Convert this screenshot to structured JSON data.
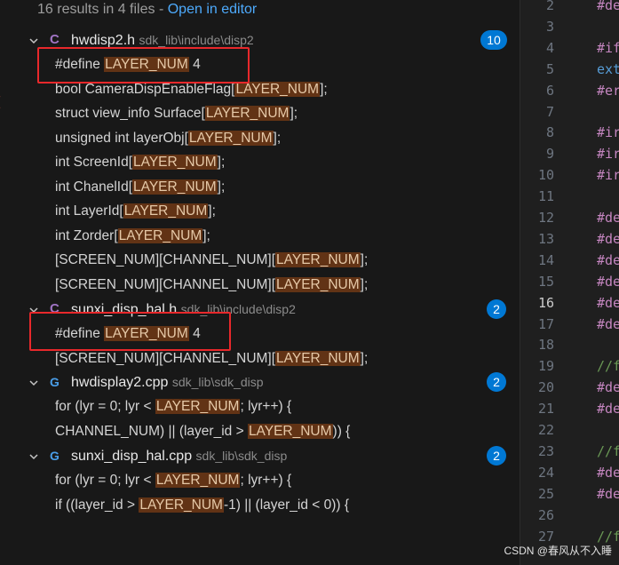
{
  "search": {
    "summary": "16 results in 4 files - ",
    "open_in_editor": "Open in editor"
  },
  "files": [
    {
      "name": "hwdisp2.h",
      "path": "sdk_lib\\include\\disp2",
      "icon": "c-header-icon",
      "icon_glyph": "C",
      "count": "10",
      "matches": [
        [
          "#define ",
          "LAYER_NUM",
          " 4"
        ],
        [
          "bool CameraDispEnableFlag[",
          "LAYER_NUM",
          "];"
        ],
        [
          "struct view_info Surface[",
          "LAYER_NUM",
          "];"
        ],
        [
          "unsigned int layerObj[",
          "LAYER_NUM",
          "];"
        ],
        [
          "int ScreenId[",
          "LAYER_NUM",
          "];"
        ],
        [
          "int ChanelId[",
          "LAYER_NUM",
          "];"
        ],
        [
          "int LayerId[",
          "LAYER_NUM",
          "];"
        ],
        [
          "int Zorder[",
          "LAYER_NUM",
          "];"
        ],
        [
          "[SCREEN_NUM][CHANNEL_NUM][",
          "LAYER_NUM",
          "];"
        ],
        [
          "[SCREEN_NUM][CHANNEL_NUM][",
          "LAYER_NUM",
          "];"
        ]
      ]
    },
    {
      "name": "sunxi_disp_hal.h",
      "path": "sdk_lib\\include\\disp2",
      "icon": "c-header-icon",
      "icon_glyph": "C",
      "count": "2",
      "matches": [
        [
          "#define ",
          "LAYER_NUM",
          " 4"
        ],
        [
          "[SCREEN_NUM][CHANNEL_NUM][",
          "LAYER_NUM",
          "];"
        ]
      ]
    },
    {
      "name": "hwdisplay2.cpp",
      "path": "sdk_lib\\sdk_disp",
      "icon": "cpp-file-icon",
      "icon_glyph": "G",
      "count": "2",
      "matches": [
        [
          "for (lyr = 0; lyr < ",
          "LAYER_NUM",
          "; lyr++) {"
        ],
        [
          "CHANNEL_NUM) || (layer_id > ",
          "LAYER_NUM",
          ")) {"
        ]
      ]
    },
    {
      "name": "sunxi_disp_hal.cpp",
      "path": "sdk_lib\\sdk_disp",
      "icon": "cpp-file-icon",
      "icon_glyph": "G",
      "count": "2",
      "matches": [
        [
          "for (lyr = 0; lyr < ",
          "LAYER_NUM",
          "; lyr++) {"
        ],
        [
          "if ((layer_id > ",
          "LAYER_NUM",
          "-1) || (layer_id < 0)) {"
        ]
      ]
    }
  ],
  "editor": {
    "active_line": "16",
    "lines": [
      {
        "n": "2",
        "code": "#de",
        "kind": "macro"
      },
      {
        "n": "3",
        "code": "",
        "kind": "none"
      },
      {
        "n": "4",
        "code": "#if",
        "kind": "macro"
      },
      {
        "n": "5",
        "code": "ext",
        "kind": "ext"
      },
      {
        "n": "6",
        "code": "#er",
        "kind": "macro"
      },
      {
        "n": "7",
        "code": "",
        "kind": "none"
      },
      {
        "n": "8",
        "code": "#ir",
        "kind": "macro"
      },
      {
        "n": "9",
        "code": "#ir",
        "kind": "macro"
      },
      {
        "n": "10",
        "code": "#ir",
        "kind": "macro"
      },
      {
        "n": "11",
        "code": "",
        "kind": "none"
      },
      {
        "n": "12",
        "code": "#de",
        "kind": "macro"
      },
      {
        "n": "13",
        "code": "#de",
        "kind": "macro"
      },
      {
        "n": "14",
        "code": "#de",
        "kind": "macro"
      },
      {
        "n": "15",
        "code": "#de",
        "kind": "macro"
      },
      {
        "n": "16",
        "code": "#de",
        "kind": "macro"
      },
      {
        "n": "17",
        "code": "#de",
        "kind": "macro"
      },
      {
        "n": "18",
        "code": "",
        "kind": "none"
      },
      {
        "n": "19",
        "code": "//f",
        "kind": "comment"
      },
      {
        "n": "20",
        "code": "#de",
        "kind": "macro"
      },
      {
        "n": "21",
        "code": "#de",
        "kind": "macro"
      },
      {
        "n": "22",
        "code": "",
        "kind": "none"
      },
      {
        "n": "23",
        "code": "//f",
        "kind": "comment"
      },
      {
        "n": "24",
        "code": "#de",
        "kind": "macro"
      },
      {
        "n": "25",
        "code": "#de",
        "kind": "macro"
      },
      {
        "n": "26",
        "code": "",
        "kind": "none"
      },
      {
        "n": "27",
        "code": "//f",
        "kind": "comment"
      }
    ]
  },
  "watermark": "CSDN @春风从不入睡",
  "colors": {
    "highlight": "#623315",
    "badge": "#0078d4",
    "annotation_box": "#e8282b",
    "link": "#4daafc"
  }
}
